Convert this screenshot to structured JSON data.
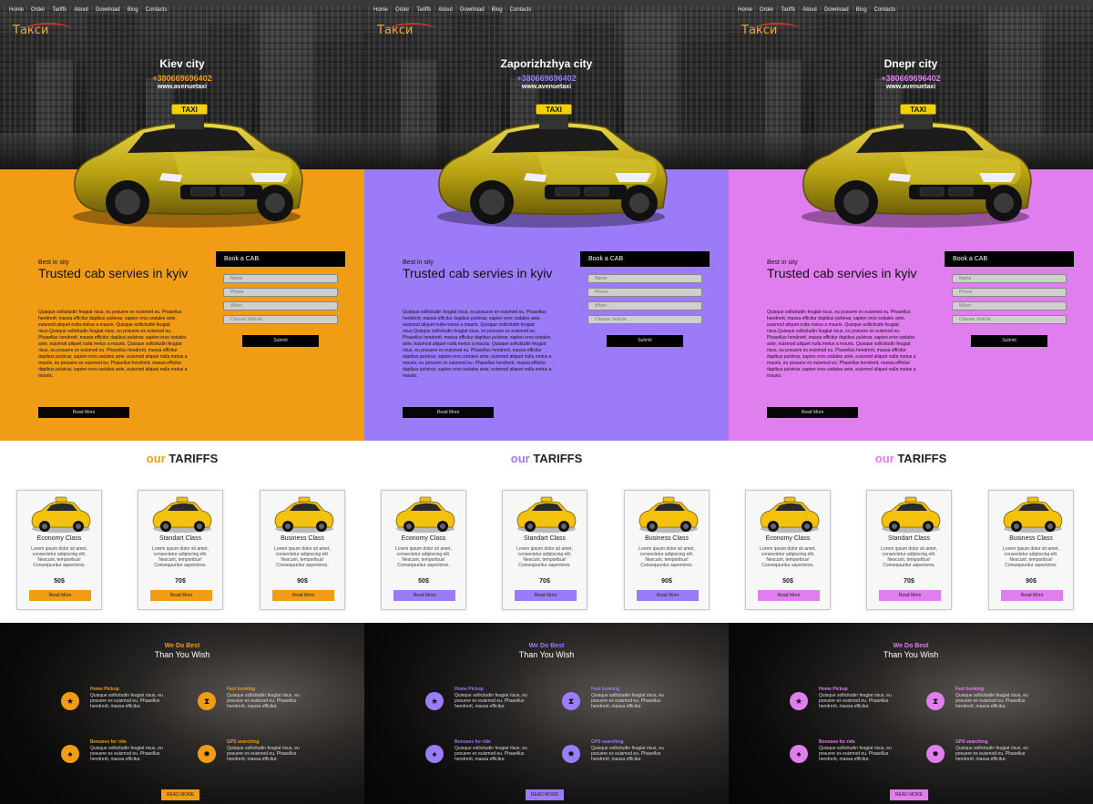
{
  "nav": [
    "Home",
    "Order",
    "Tariffs",
    "About",
    "Download",
    "Blog",
    "Contacts"
  ],
  "logo": "Такси",
  "hero": {
    "site": "www.avenuetaxi",
    "taxi_sign": "TAXI"
  },
  "intro": {
    "best": "Best in sity",
    "trusted": "Trusted cab servies in kyiv",
    "read_more": "Read More"
  },
  "booking": {
    "title": "Book a CAB",
    "fields": [
      "Name",
      "Phone",
      "When",
      "Choose Vehicle"
    ],
    "submit": "Submit"
  },
  "tariffs": {
    "our": "our",
    "title": "TARIFFS"
  },
  "plans": [
    {
      "name": "Economy Class",
      "price": "50$",
      "desc": "Lorem ipsum dolor sit amet, consectetur adipiscing elit. Nescunt, temporibus! Consequuntur asperiores.",
      "button": "Read More"
    },
    {
      "name": "Standart Class",
      "price": "70$",
      "desc": "Lorem ipsum dolor sit amet, consectetur adipiscing elit. Nescunt, temporibus! Consequuntur asperiores.",
      "button": "Read More"
    },
    {
      "name": "Business Class",
      "price": "90$",
      "desc": "Lorem ipsum dolor sit amet, consectetur adipiscing elit. Nescunt, temporibus! Consequuntur asperiores.",
      "button": "Read More"
    }
  ],
  "bestsection": {
    "line1": "We Do Best",
    "line2": "Than You Wish",
    "read_more": "READ MORE"
  },
  "features": [
    {
      "title": "Home Pickup",
      "text": "Quisque sollicitudin feugiat risus, eu posuere ex euismod eu. Phasellus hendrerit, massa efficitur.",
      "icon": "star-icon",
      "glyph": "★"
    },
    {
      "title": "Fast booking",
      "text": "Quisque sollicitudin feugiat risus, eu posuere ex euismod eu. Phasellus hendrerit, massa efficitur.",
      "icon": "hourglass-icon",
      "glyph": "⧗"
    },
    {
      "title": "Bonuses for ride",
      "text": "Quisque sollicitudin feugiat risus, eu posuere ex euismod eu. Phasellus hendrerit, massa efficitur.",
      "icon": "gift-icon",
      "glyph": "♠"
    },
    {
      "title": "GPS searching",
      "text": "Quisque sollicitudin feugiat risus, eu posuere ex euismod eu. Phasellus hendrerit, massa efficitur.",
      "icon": "gps-icon",
      "glyph": "✹"
    }
  ],
  "lorem": "Quisque sollicitudin feugiat risus, eu posuere ex euismod eu. Phasellus hendrerit, massa efficitur dapibus pulvinar, sapien eros sodales ante, euismod aliquet nulla metus a mauris. Quisque sollicitudin feugiat risus.Quisque sollicitudin feugiat risus, eu posuere ex euismod eu. Phasellus hendrerit, massa efficitur dapibus pulvinar, sapien eros sodales ante, euismod aliquet nulla metus a mauris. Quisque sollicitudin feugiat risus, eu posuere ex euismod eu. Phasellus hendrerit, massa efficitur dapibus pulvinar, sapien eros sodales ante, euismod aliquet nulla metus a mauris, eu posuere ex euismod eu. Phasellus hendrerit, massa efficitur dapibus pulvinar, sapien eros sodales ante, euismod aliquet nulla metus a mauris.",
  "variants": [
    {
      "city": "Kiev city",
      "phone": "+380669696402",
      "accent": "#f09c14"
    },
    {
      "city": "Zaporizhzhya city",
      "phone": "+380669696402",
      "accent": "#9b7bf7"
    },
    {
      "city": "Dnepr city",
      "phone": "+380669696402",
      "accent": "#e07ef0"
    }
  ]
}
